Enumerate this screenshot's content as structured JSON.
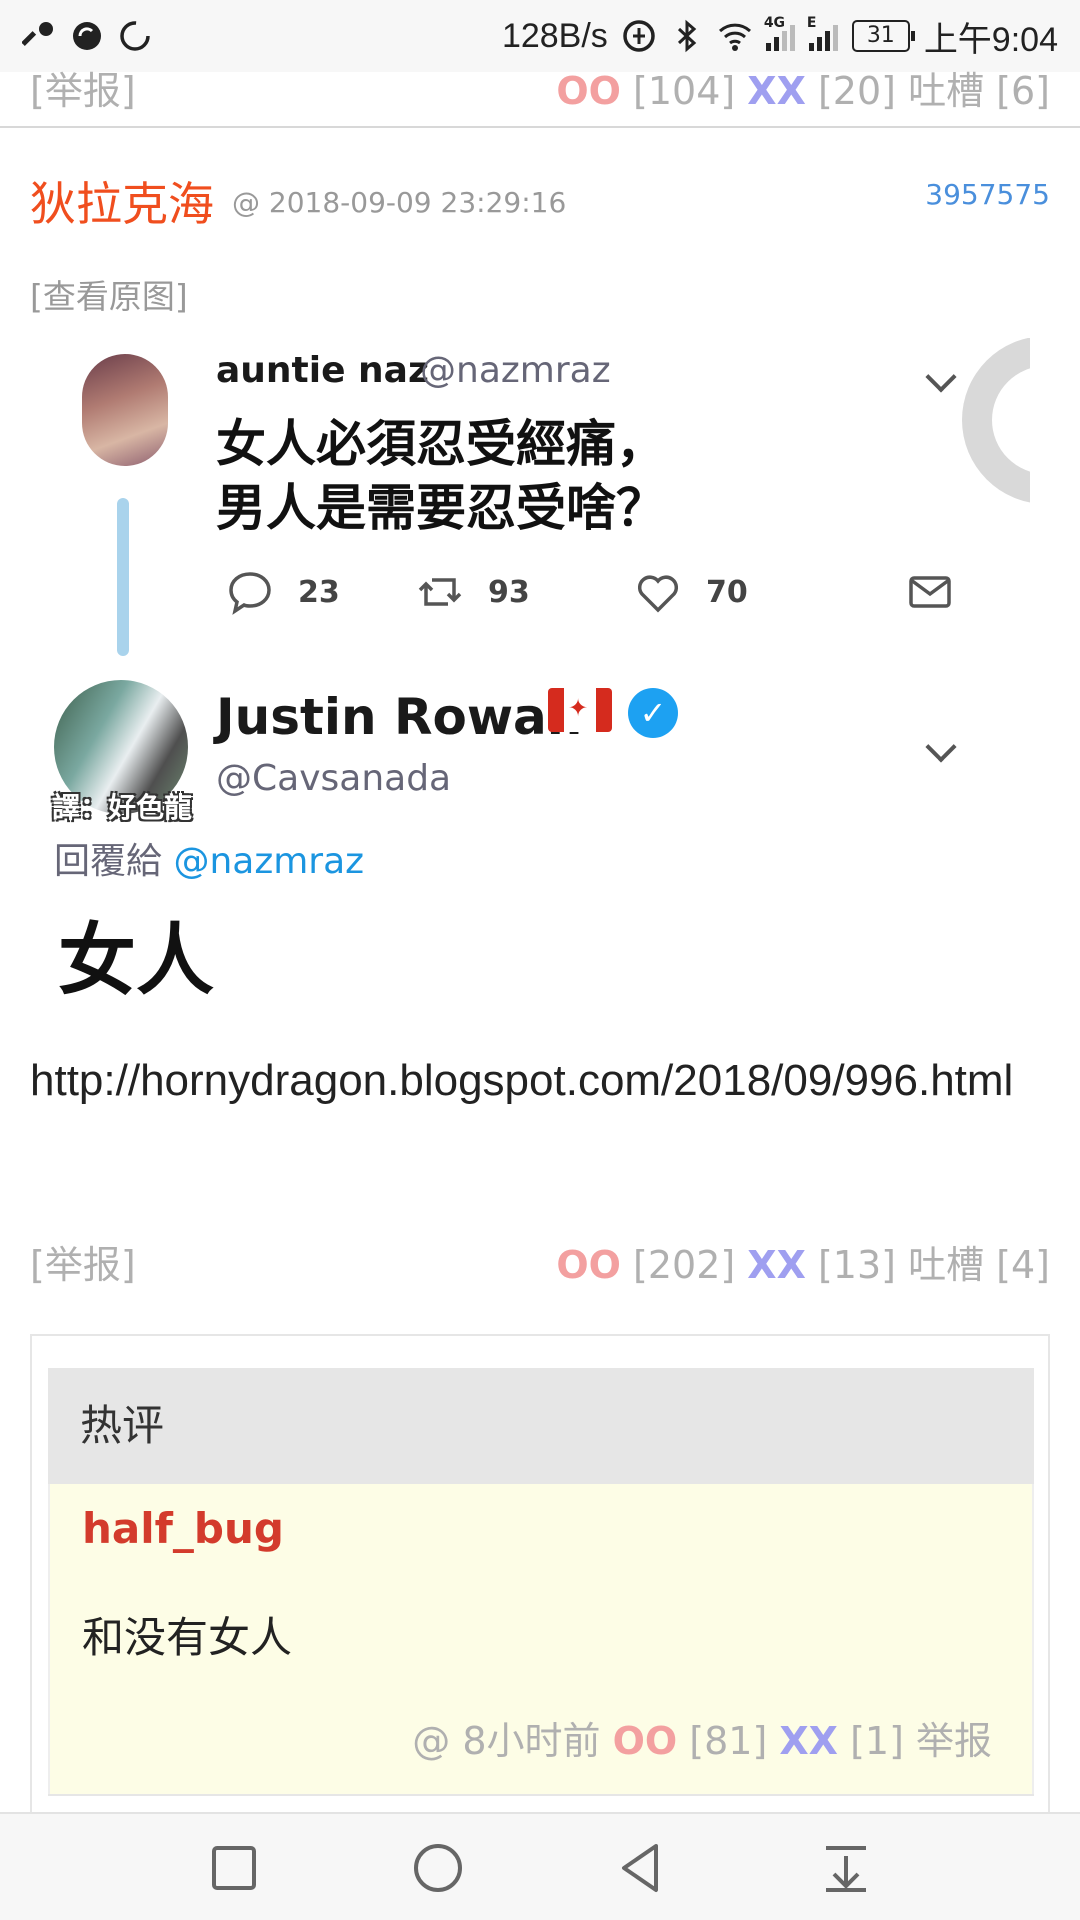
{
  "status_bar": {
    "net_speed": "128B/s",
    "signal_1_tag": "4G",
    "signal_2_tag": "E",
    "battery": "31",
    "time": "上午9:04"
  },
  "prev_comment": {
    "report": "[举报]",
    "oo_label": "OO",
    "oo_count": " [104] ",
    "xx_label": "XX",
    "xx_count": " [20] ",
    "tucao": "吐槽 [6]"
  },
  "post": {
    "author": "狄拉克海",
    "time": "@ 2018-09-09 23:29:16",
    "id": "3957575",
    "view_original": "[查看原图]",
    "image": {
      "tweet1": {
        "name": "auntie naz",
        "handle": "@nazmraz",
        "text_line1": "女人必須忍受經痛，",
        "text_line2": "男人是需要忍受啥？",
        "replies": "23",
        "retweets": "93",
        "likes": "70"
      },
      "tweet2": {
        "name": "Justin Rowan",
        "handle": "@Cavsanada",
        "reply_prefix": "回覆給 ",
        "reply_handle": "@nazmraz",
        "text": "女人"
      },
      "watermark": "譯：好色龍"
    },
    "link_text": "http://hornydragon.blogspot.com/2018/09/996.html",
    "footer": {
      "report": "[举报]",
      "oo_label": "OO",
      "oo_count": " [202] ",
      "xx_label": "XX",
      "xx_count": " [13] ",
      "tucao": "吐槽 [4]"
    }
  },
  "hot_comments": {
    "header": "热评",
    "items": [
      {
        "user": "half_bug",
        "text": "和没有女人",
        "time": "@  8小时前  ",
        "oo_label": "OO",
        "oo_count": " [81]   ",
        "xx_label": "XX",
        "xx_count": " [1]  ",
        "report": "举报"
      }
    ]
  },
  "colors": {
    "author": "#f04e1e",
    "oo": "#f3a0a0",
    "xx": "#9f9ff0",
    "link_blue": "#4a8fdc",
    "hot_user": "#d33b2c",
    "hot_bg": "#fdfde6"
  },
  "icons": {
    "status_left": [
      "key-icon",
      "sync-icon",
      "loading-icon"
    ],
    "nav": [
      "recent-apps-icon",
      "home-icon",
      "back-icon",
      "notification-pulldown-icon"
    ]
  }
}
